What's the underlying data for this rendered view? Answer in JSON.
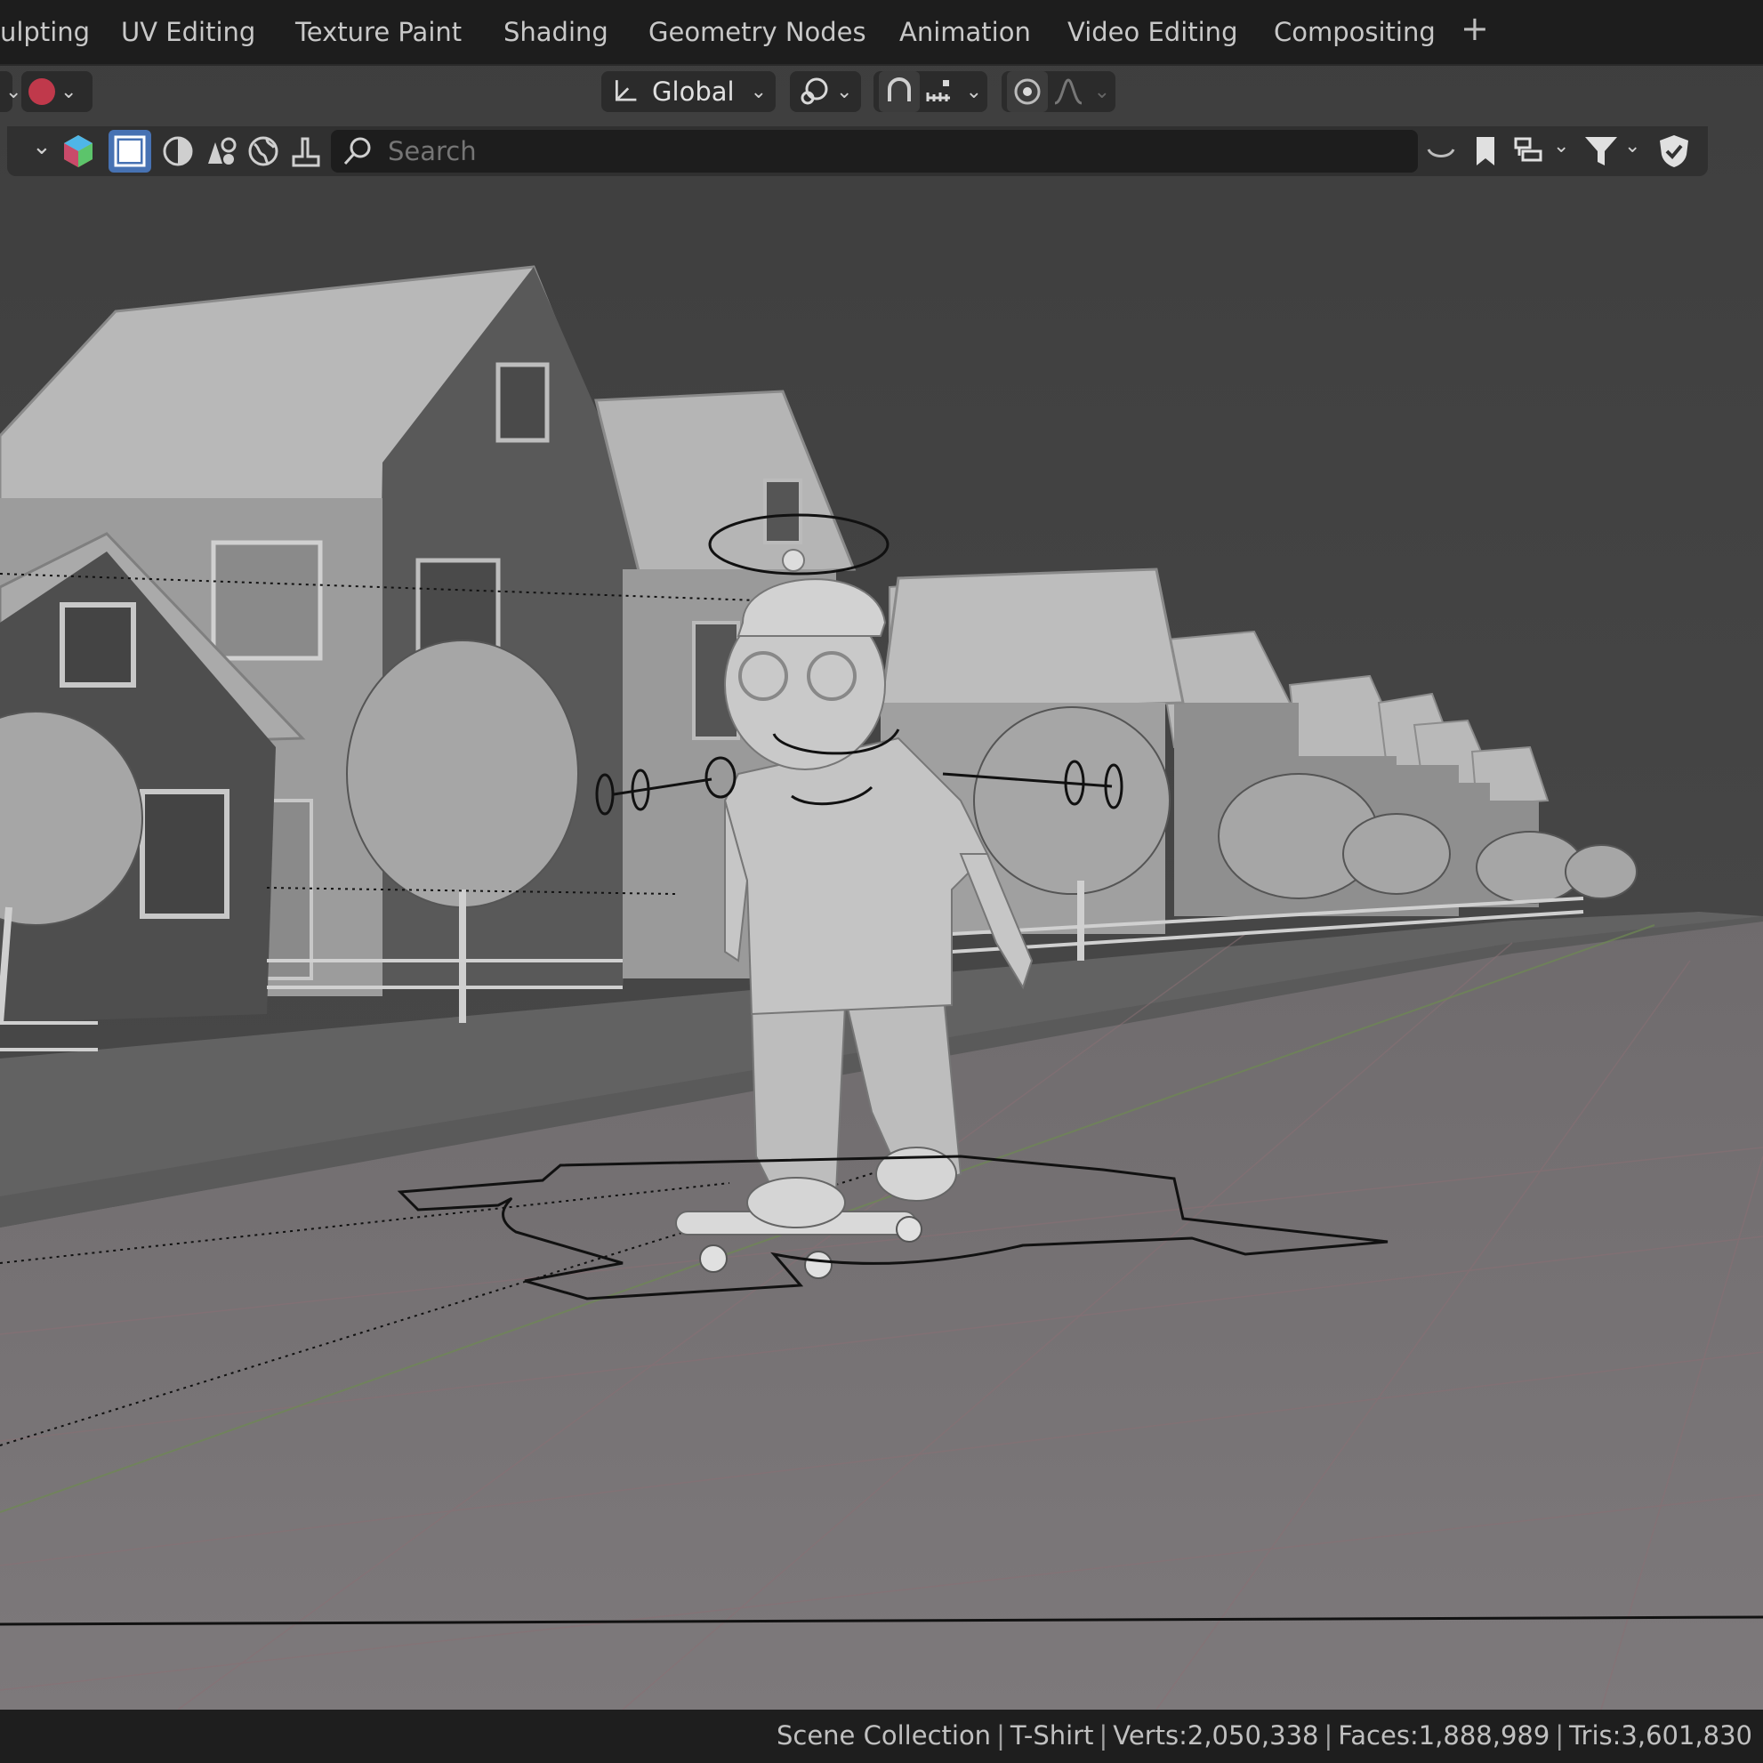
{
  "workspace_tabs": [
    {
      "label": "ulpting"
    },
    {
      "label": "UV Editing"
    },
    {
      "label": "Texture Paint"
    },
    {
      "label": "Shading"
    },
    {
      "label": "Geometry Nodes"
    },
    {
      "label": "Animation"
    },
    {
      "label": "Video Editing"
    },
    {
      "label": "Compositing"
    }
  ],
  "add_workspace": "+",
  "header": {
    "transform_orientation": "Global",
    "icons": [
      "editor-type-icon",
      "transform-orientation-icon",
      "pivot-point-icon",
      "snap-icon",
      "snap-increment-icon",
      "proportional-edit-icon",
      "falloff-icon"
    ]
  },
  "outliner_header": {
    "search_placeholder": "Search",
    "filter_icons": [
      "restrict-select-icon",
      "viewport-shading-solid-icon",
      "material-icon",
      "world-icon",
      "brush-icon"
    ],
    "right_icons": [
      "sync-icon",
      "bookmark-icon",
      "display-mode-icon",
      "filter-icon",
      "shield-icon"
    ]
  },
  "viewport": {
    "shading": "solid"
  },
  "status_bar": {
    "collection": "Scene Collection",
    "object": "T-Shirt",
    "verts": "Verts:2,050,338",
    "faces": "Faces:1,888,989",
    "tris": "Tris:3,601,830"
  },
  "colors": {
    "topbar_bg": "#1d1d1d",
    "viewport_bg": "#4a4a4a",
    "selection_blue": "#4772b3"
  }
}
